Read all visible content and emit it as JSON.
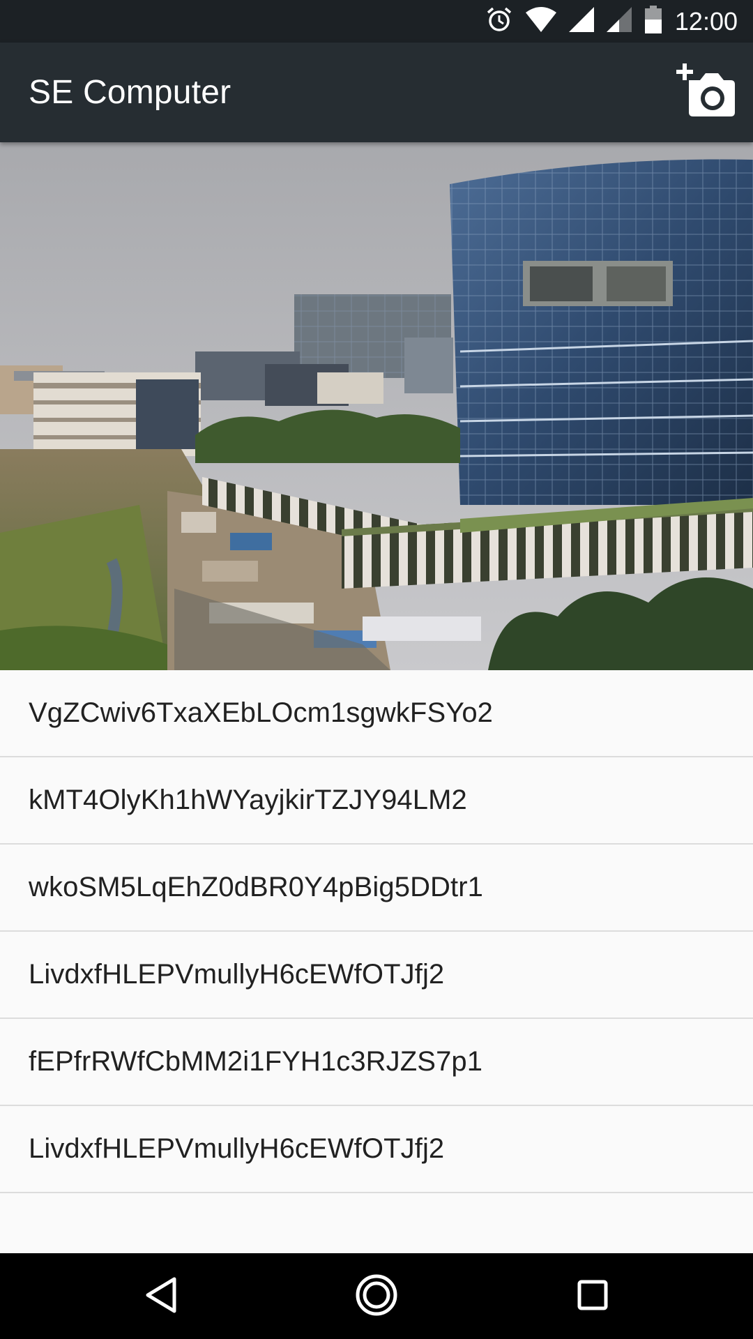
{
  "status_bar": {
    "time": "12:00",
    "icons": [
      "alarm-icon",
      "wifi-icon",
      "signal-icon",
      "signal-secondary-icon",
      "battery-icon"
    ]
  },
  "app_bar": {
    "title": "SE Computer",
    "action_icon": "add-photo-camera-icon",
    "background": "#262d32"
  },
  "hero_image": {
    "subject": "city-skyline-photo"
  },
  "list": {
    "items": [
      {
        "label": "VgZCwiv6TxaXEbLOcm1sgwkFSYo2"
      },
      {
        "label": "kMT4OlyKh1hWYayjkirTZJY94LM2"
      },
      {
        "label": "wkoSM5LqEhZ0dBR0Y4pBig5DDtr1"
      },
      {
        "label": "LivdxfHLEPVmullyH6cEWfOTJfj2"
      },
      {
        "label": "fEPfrRWfCbMM2i1FYH1c3RJZS7p1"
      },
      {
        "label": "LivdxfHLEPVmullyH6cEWfOTJfj2"
      }
    ]
  },
  "nav_bar": {
    "buttons": [
      "back-icon",
      "home-icon",
      "recents-icon"
    ]
  }
}
